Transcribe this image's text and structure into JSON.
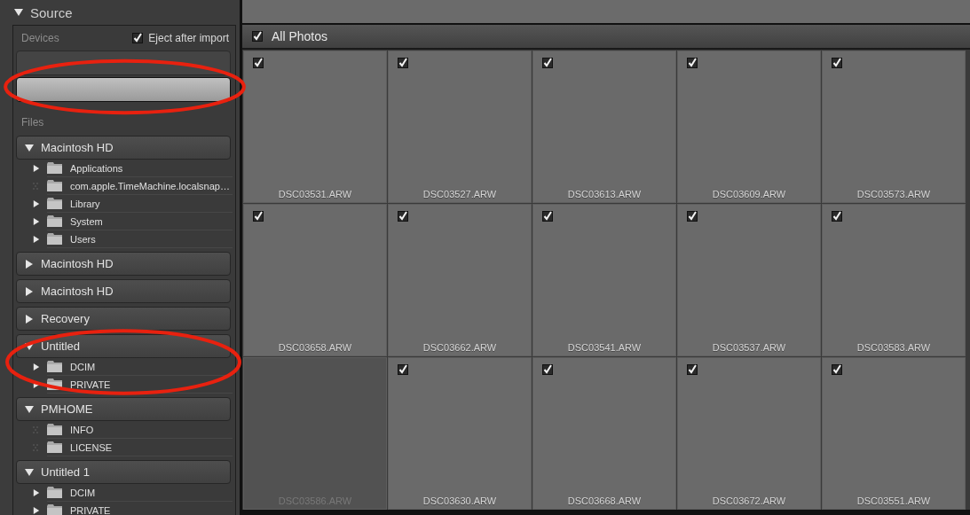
{
  "source_panel": {
    "title": "Source",
    "expanded": true,
    "devices_label": "Devices",
    "eject_after_import": {
      "label": "Eject after import",
      "checked": true
    },
    "devices": [
      {
        "selected": false,
        "circled": false
      },
      {
        "selected": true,
        "circled": true
      }
    ],
    "files_label": "Files",
    "volumes": [
      {
        "name": "Macintosh HD",
        "expanded": true,
        "circled": false,
        "children": [
          {
            "name": "Applications",
            "has_children": true
          },
          {
            "name": "com.apple.TimeMachine.localsnap…",
            "has_children": false
          },
          {
            "name": "Library",
            "has_children": true
          },
          {
            "name": "System",
            "has_children": true
          },
          {
            "name": "Users",
            "has_children": true
          }
        ]
      },
      {
        "name": "Macintosh HD",
        "expanded": false,
        "circled": false
      },
      {
        "name": "Macintosh HD",
        "expanded": false,
        "circled": false
      },
      {
        "name": "Recovery",
        "expanded": false,
        "circled": false
      },
      {
        "name": "Untitled",
        "expanded": true,
        "circled": true,
        "children": [
          {
            "name": "DCIM",
            "has_children": true
          },
          {
            "name": "PRIVATE",
            "has_children": true
          }
        ]
      },
      {
        "name": "PMHOME",
        "expanded": true,
        "circled": false,
        "children": [
          {
            "name": "INFO",
            "has_children": false
          },
          {
            "name": "LICENSE",
            "has_children": false
          }
        ]
      },
      {
        "name": "Untitled 1",
        "expanded": true,
        "circled": false,
        "children": [
          {
            "name": "DCIM",
            "has_children": true
          },
          {
            "name": "PRIVATE",
            "has_children": true
          }
        ]
      }
    ]
  },
  "grid": {
    "header": {
      "label": "All Photos",
      "checked": true
    },
    "photos": [
      {
        "name": "DSC03531.ARW",
        "checked": true
      },
      {
        "name": "DSC03527.ARW",
        "checked": true
      },
      {
        "name": "DSC03613.ARW",
        "checked": true
      },
      {
        "name": "DSC03609.ARW",
        "checked": true
      },
      {
        "name": "DSC03573.ARW",
        "checked": true
      },
      {
        "name": "DSC03658.ARW",
        "checked": true
      },
      {
        "name": "DSC03662.ARW",
        "checked": true
      },
      {
        "name": "DSC03541.ARW",
        "checked": true
      },
      {
        "name": "DSC03537.ARW",
        "checked": true
      },
      {
        "name": "DSC03583.ARW",
        "checked": true
      },
      {
        "name": "DSC03586.ARW",
        "checked": false
      },
      {
        "name": "DSC03630.ARW",
        "checked": true
      },
      {
        "name": "DSC03668.ARW",
        "checked": true
      },
      {
        "name": "DSC03672.ARW",
        "checked": true
      },
      {
        "name": "DSC03551.ARW",
        "checked": true
      }
    ]
  }
}
